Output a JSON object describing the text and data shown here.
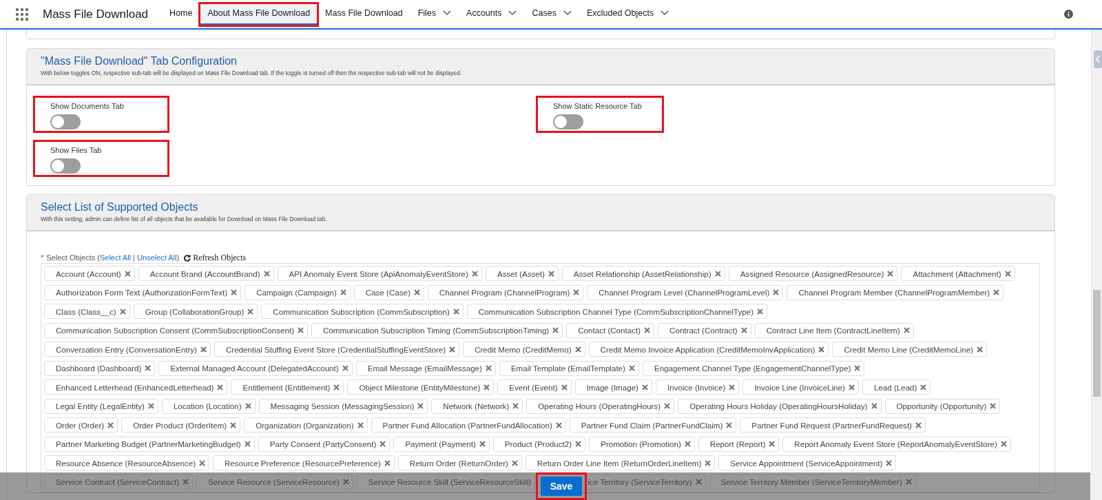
{
  "app_title": "Mass File Download",
  "nav_tabs": [
    {
      "label": "Home",
      "selected": false,
      "dropdown": false,
      "highlighted": false
    },
    {
      "label": "About Mass File Download",
      "selected": true,
      "dropdown": false,
      "highlighted": true
    },
    {
      "label": "Mass File Download",
      "selected": false,
      "dropdown": false,
      "highlighted": false
    },
    {
      "label": "Files",
      "selected": false,
      "dropdown": true,
      "highlighted": false
    },
    {
      "label": "Accounts",
      "selected": false,
      "dropdown": true,
      "highlighted": false
    },
    {
      "label": "Cases",
      "selected": false,
      "dropdown": true,
      "highlighted": false
    },
    {
      "label": "Excluded Objects",
      "selected": false,
      "dropdown": true,
      "highlighted": false
    }
  ],
  "tab_configuration": {
    "title": "\"Mass File Download\" Tab Configuration",
    "description": "With below toggles ON, respective sub-tab will be displayed on Mass File Download tab. If the toggle is turned off then the respective sub-tab will not be displayed.",
    "left_toggles": [
      {
        "label": "Show Documents Tab",
        "on": false,
        "highlighted": true
      },
      {
        "label": "Show Files Tab",
        "on": false,
        "highlighted": true
      }
    ],
    "right_toggles": [
      {
        "label": "Show Static Resource Tab",
        "on": false,
        "highlighted": true
      }
    ]
  },
  "supported_objects": {
    "title": "Select List of Supported Objects",
    "description": "With this setting, admin can define list of all objects that be available for Download on Mass File Download tab.",
    "required_mark": "*",
    "field_label": "Select Objects (",
    "select_all": "Select All",
    "separator": "|",
    "unselect_all": "Unselect All",
    "field_label_end": ")",
    "refresh": "Refresh Objects",
    "lines": [
      {
        "pills": [
          "Account (Account)",
          "Account Brand (AccountBrand)",
          "API Anomaly Event Store (ApiAnomalyEventStore)",
          "Asset (Asset)",
          "Asset Relationship (AssetRelationship)",
          "Assigned Resource (AssignedResource)",
          "Attachment (Attachment)"
        ]
      },
      {
        "pills": [
          "Authorization Form Text (AuthorizationFormText)",
          "Campaign (Campaign)",
          "Case (Case)",
          "Channel Program (ChannelProgram)",
          "Channel Program Level (ChannelProgramLevel)",
          "Channel Program Member (ChannelProgramMember)"
        ]
      },
      {
        "pills": [
          "Class (Class__c)",
          "Group (CollaborationGroup)",
          "Communication Subscription (CommSubscription)",
          "Communication Subscription Channel Type (CommSubscriptionChannelType)"
        ]
      },
      {
        "pills": [
          "Communication Subscription Consent (CommSubscriptionConsent)",
          "Communication Subscription Timing (CommSubscriptionTiming)",
          "Contact (Contact)",
          "Contract (Contract)",
          "Contract Line Item (ContractLineItem)"
        ]
      },
      {
        "pills": [
          "Conversation Entry (ConversationEntry)",
          "Credential Stuffing Event Store (CredentialStuffingEventStore)",
          "Credit Memo (CreditMemo)",
          "Credit Memo Invoice Application (CreditMemoInvApplication)",
          "Credit Memo Line (CreditMemoLine)"
        ]
      },
      {
        "pills": [
          "Dashboard (Dashboard)",
          "External Managed Account (DelegatedAccount)",
          "Email Message (EmailMessage)",
          "Email Template (EmailTemplate)",
          "Engagement Channel Type (EngagementChannelType)"
        ]
      },
      {
        "pills": [
          "Enhanced Letterhead (EnhancedLetterhead)",
          "Entitlement (Entitlement)",
          "Object Milestone (EntityMilestone)",
          "Event (Event)",
          "Image (Image)",
          "Invoice (Invoice)",
          "Invoice Line (InvoiceLine)",
          "Lead (Lead)"
        ]
      },
      {
        "pills": [
          "Legal Entity (LegalEntity)",
          "Location (Location)",
          "Messaging Session (MessagingSession)",
          "Network (Network)",
          "Operating Hours (OperatingHours)",
          "Operating Hours Holiday (OperatingHoursHoliday)",
          "Opportunity (Opportunity)"
        ]
      },
      {
        "pills": [
          "Order (Order)",
          "Order Product (OrderItem)",
          "Organization (Organization)",
          "Partner Fund Allocation (PartnerFundAllocation)",
          "Partner Fund Claim (PartnerFundClaim)",
          "Partner Fund Request (PartnerFundRequest)"
        ]
      },
      {
        "pills": [
          "Partner Marketing Budget (PartnerMarketingBudget)",
          "Party Consent (PartyConsent)",
          "Payment (Payment)",
          "Product (Product2)",
          "Promotion (Promotion)",
          "Report (Report)",
          "Report Anomaly Event Store (ReportAnomalyEventStore)"
        ]
      },
      {
        "pills": [
          "Resource Absence (ResourceAbsence)",
          "Resource Preference (ResourcePreference)",
          "Return Order (ReturnOrder)",
          "Return Order Line Item (ReturnOrderLineItem)",
          "Service Appointment (ServiceAppointment)"
        ]
      },
      {
        "pills": [
          "Service Contract (ServiceContract)",
          "Service Resource (ServiceResource)",
          {
            "label": "Service Resource Skill (ServiceResourceSkill)",
            "remove_icon": false
          },
          {
            "label": "ice Territory (ServiceTerritory)",
            "cut_off": true
          },
          "Service Territory Member (ServiceTerritoryMember)"
        ]
      }
    ]
  },
  "footer": {
    "save": "Save",
    "highlighted": true
  }
}
